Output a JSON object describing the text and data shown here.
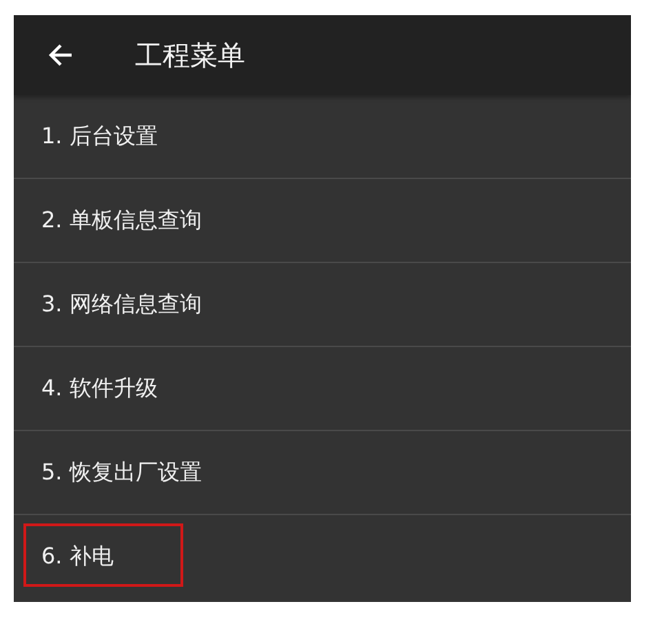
{
  "header": {
    "title": "工程菜单"
  },
  "menu_items": [
    {
      "label": "1. 后台设置",
      "highlighted": false
    },
    {
      "label": "2. 单板信息查询",
      "highlighted": false
    },
    {
      "label": "3. 网络信息查询",
      "highlighted": false
    },
    {
      "label": "4. 软件升级",
      "highlighted": false
    },
    {
      "label": "5. 恢复出厂设置",
      "highlighted": false
    },
    {
      "label": "6. 补电",
      "highlighted": true
    }
  ]
}
